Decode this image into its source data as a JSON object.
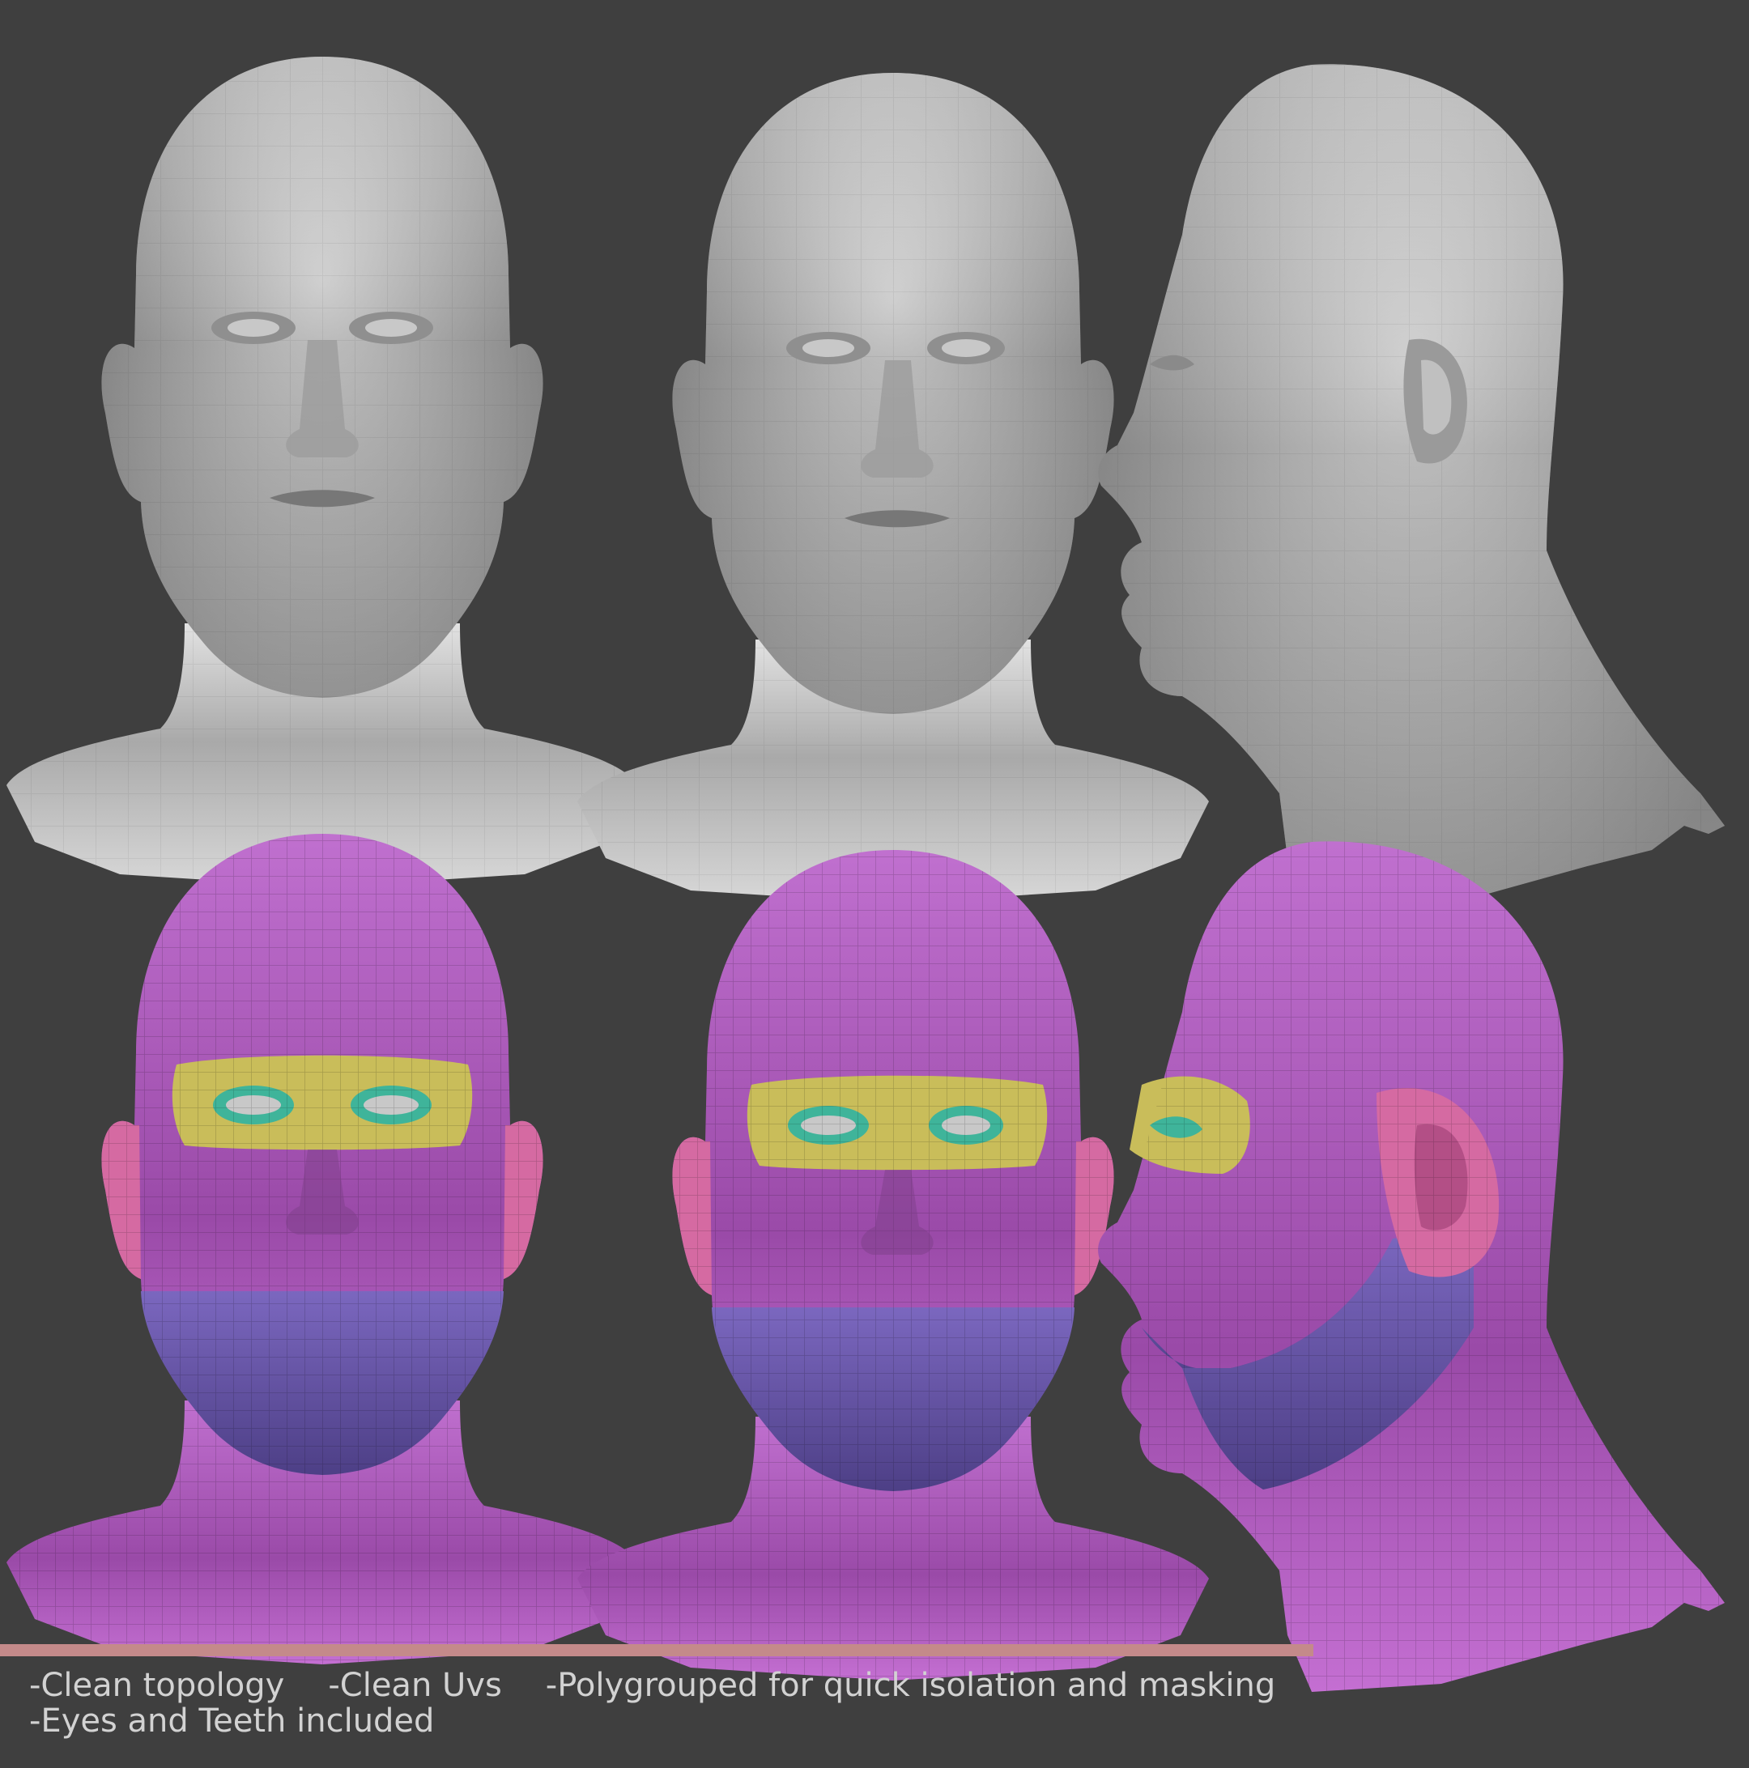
{
  "colors": {
    "background": "#3f3f3f",
    "clay": "#b8b8b8",
    "polygroup_skin": "#b65cc2",
    "polygroup_jaw": "#6f5bb0",
    "polygroup_brow": "#cbc05a",
    "polygroup_lid": "#3fb49a",
    "polygroup_ear": "#d76aa3",
    "accent_line": "#c48a8a",
    "text": "#d2d2d2"
  },
  "renders": [
    {
      "view": "front",
      "material": "clay"
    },
    {
      "view": "three-quarter",
      "material": "clay"
    },
    {
      "view": "profile",
      "material": "clay"
    },
    {
      "view": "front",
      "material": "polygroups"
    },
    {
      "view": "three-quarter",
      "material": "polygroups"
    },
    {
      "view": "profile",
      "material": "polygroups"
    }
  ],
  "features": {
    "line1": [
      "-Clean topology",
      "-Clean Uvs",
      "-Polygrouped for quick isolation and masking"
    ],
    "line2": [
      "-Eyes and Teeth included"
    ]
  }
}
